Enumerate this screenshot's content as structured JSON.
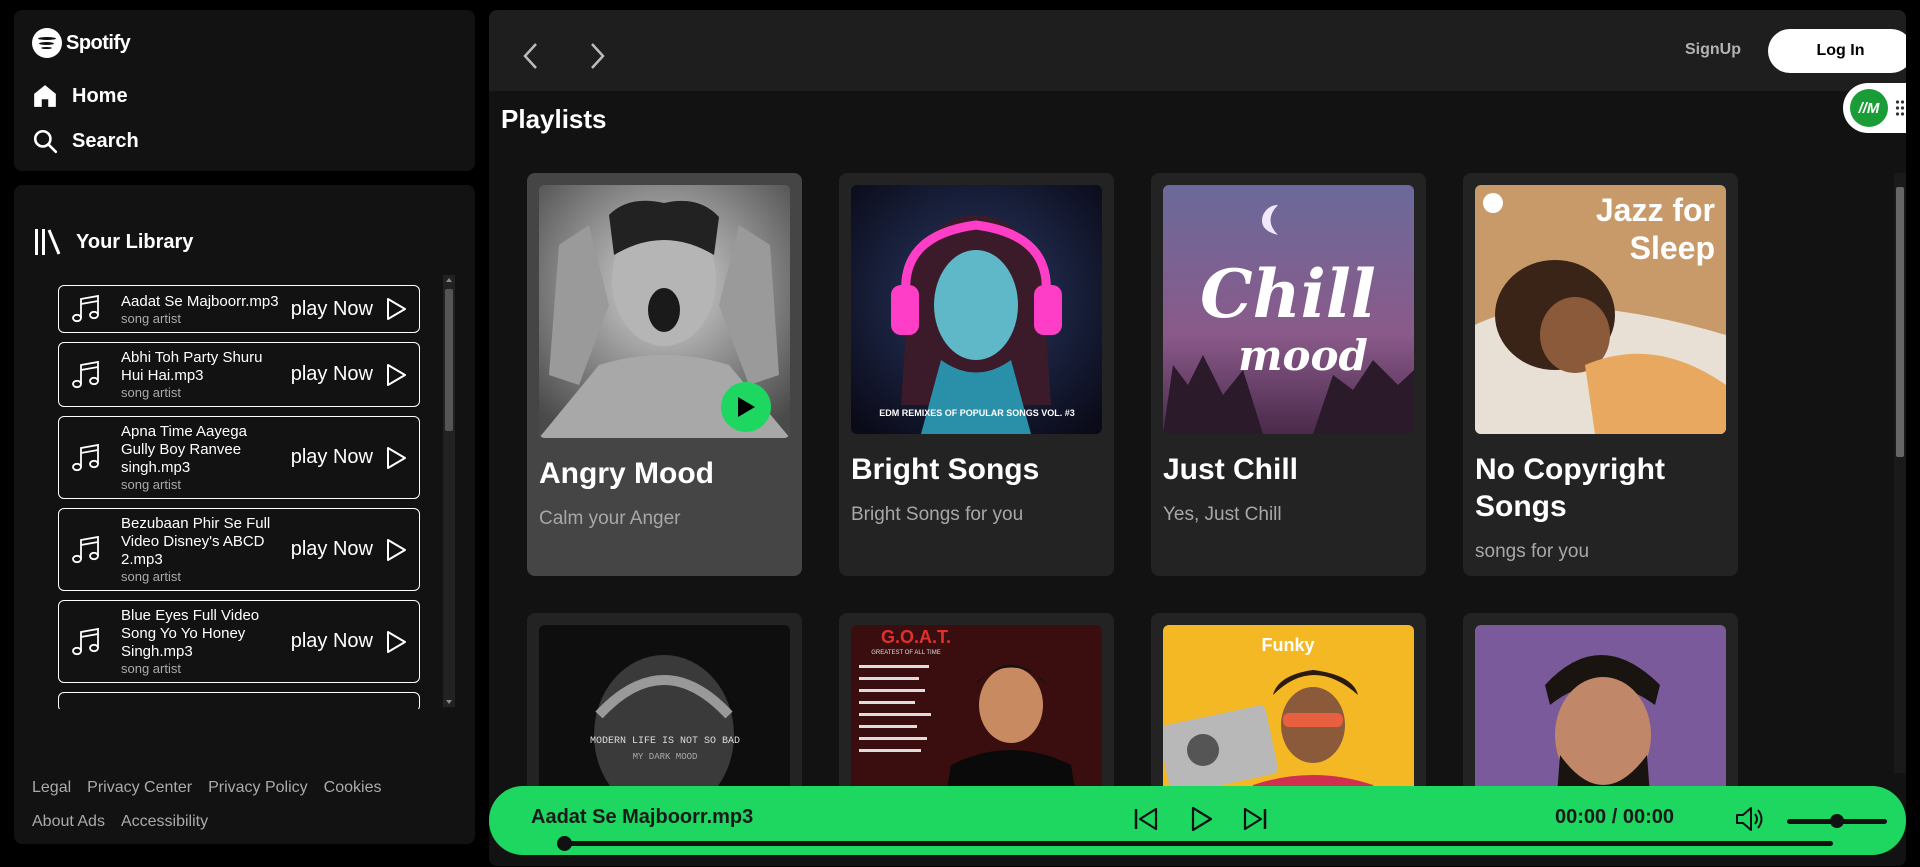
{
  "brand": {
    "name": "Spotify"
  },
  "nav": {
    "home": "Home",
    "search": "Search"
  },
  "library": {
    "title": "Your Library",
    "items": [
      {
        "title": "Aadat Se Majboorr.mp3",
        "artist": "song artist",
        "action": "play Now"
      },
      {
        "title": "Abhi Toh Party Shuru Hui Hai.mp3",
        "artist": "song artist",
        "action": "play Now"
      },
      {
        "title": "Apna Time Aayega Gully Boy Ranvee singh.mp3",
        "artist": "song artist",
        "action": "play Now"
      },
      {
        "title": "Bezubaan Phir Se Full Video Disney's ABCD 2.mp3",
        "artist": "song artist",
        "action": "play Now"
      },
      {
        "title": "Blue Eyes Full Video Song Yo Yo Honey Singh.mp3",
        "artist": "song artist",
        "action": "play Now"
      }
    ]
  },
  "footer": {
    "links": [
      "Legal",
      "Privacy Center",
      "Privacy Policy",
      "Cookies",
      "About Ads",
      "Accessibility"
    ]
  },
  "header": {
    "signup": "SignUp",
    "login": "Log In",
    "badge": "//M"
  },
  "main": {
    "section_title": "Playlists",
    "playlists": [
      {
        "title": "Angry Mood",
        "subtitle": "Calm your Anger",
        "active": true
      },
      {
        "title": "Bright Songs",
        "subtitle": "Bright Songs for you"
      },
      {
        "title": "Just Chill",
        "subtitle": "Yes, Just Chill"
      },
      {
        "title": "No Copyright Songs",
        "subtitle": "songs for you"
      }
    ],
    "cover_text": {
      "edm": "EDM REMIXES OF POPULAR SONGS VOL. #3",
      "chill": "Chill",
      "mood": "mood",
      "jazz_line1": "Jazz for",
      "jazz_line2": "Sleep",
      "row2_1": "MODERN LIFE IS NOT SO BAD",
      "row2_1b": "MY DARK MOOD",
      "row2_2": "G.O.A.T.",
      "row2_2b": "GREATEST OF ALL TIME",
      "row2_3": "Funky"
    }
  },
  "player": {
    "now_playing": "Aadat Se Majboorr.mp3",
    "time": "00:00 / 00:00",
    "progress": 0,
    "volume": 0.5
  },
  "colors": {
    "accent": "#1ed760",
    "background": "#000000",
    "panel": "#121212"
  }
}
